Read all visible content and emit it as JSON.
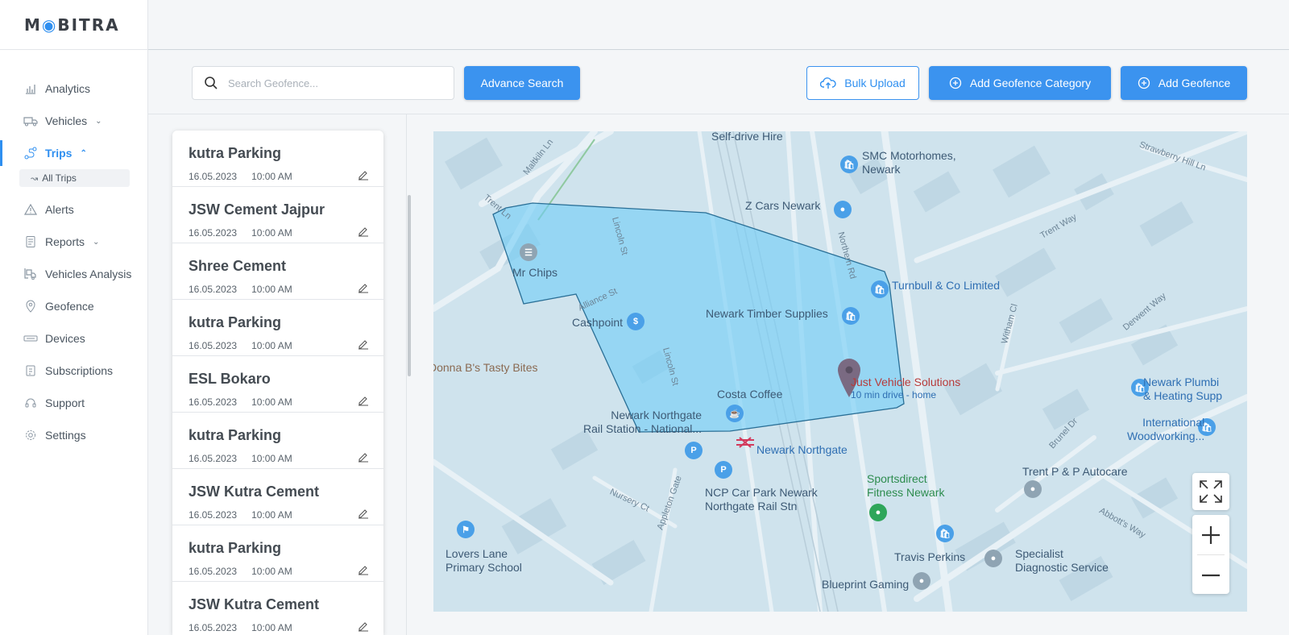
{
  "app": {
    "logo": "MOBITRA"
  },
  "sidebar": {
    "items": [
      {
        "label": "Analytics",
        "icon": "chart-icon"
      },
      {
        "label": "Vehicles",
        "icon": "truck-icon",
        "chevron": "down"
      },
      {
        "label": "Trips",
        "icon": "route-icon",
        "chevron": "up",
        "active": true
      },
      {
        "label": "Alerts",
        "icon": "alert-icon"
      },
      {
        "label": "Reports",
        "icon": "report-icon",
        "chevron": "down"
      },
      {
        "label": "Vehicles Analysis",
        "icon": "truck-analysis-icon"
      },
      {
        "label": "Geofence",
        "icon": "location-pin-icon"
      },
      {
        "label": "Devices",
        "icon": "device-icon"
      },
      {
        "label": "Subscriptions",
        "icon": "subscription-icon"
      },
      {
        "label": "Support",
        "icon": "headset-icon"
      },
      {
        "label": "Settings",
        "icon": "gear-icon"
      }
    ],
    "sub_item": {
      "label": "All Trips",
      "icon": "route-icon"
    }
  },
  "toolbar": {
    "search_placeholder": "Search Geofence...",
    "advance_search": "Advance Search",
    "bulk_upload": "Bulk Upload",
    "add_category": "Add Geofence Category",
    "add_geofence": "Add Geofence",
    "accent": "#3b93ef"
  },
  "geofences": [
    {
      "name": "kutra Parking",
      "date": "16.05.2023",
      "time": "10:00 AM"
    },
    {
      "name": "JSW Cement Jajpur",
      "date": "16.05.2023",
      "time": "10:00 AM"
    },
    {
      "name": "Shree Cement",
      "date": "16.05.2023",
      "time": "10:00 AM"
    },
    {
      "name": "kutra Parking",
      "date": "16.05.2023",
      "time": "10:00 AM"
    },
    {
      "name": "ESL Bokaro",
      "date": "16.05.2023",
      "time": "10:00 AM"
    },
    {
      "name": "kutra Parking",
      "date": "16.05.2023",
      "time": "10:00 AM"
    },
    {
      "name": "JSW Kutra Cement",
      "date": "16.05.2023",
      "time": "10:00 AM"
    },
    {
      "name": "kutra Parking",
      "date": "16.05.2023",
      "time": "10:00 AM"
    },
    {
      "name": "JSW Kutra Cement",
      "date": "16.05.2023",
      "time": "10:00 AM"
    }
  ],
  "map": {
    "places": {
      "self_drive": "Self-drive Hire",
      "smc": "SMC Motorhomes,\nNewark",
      "zcars": "Z Cars Newark",
      "mrchips": "Mr Chips",
      "turnbull": "Turnbull & Co Limited",
      "timber": "Newark Timber Supplies",
      "cashpoint": "Cashpoint",
      "donna": "Donna B's Tasty Bites",
      "jvs": "Just Vehicle Solutions",
      "jvs_sub": "10 min drive - home",
      "costa": "Costa Coffee",
      "station": "Newark Northgate\nRail Station - National...",
      "northgate": "Newark Northgate",
      "ncp": "NCP Car Park Newark\nNorthgate Rail Stn",
      "sportsdirect": "Sportsdirect\nFitness Newark",
      "lovers": "Lovers Lane\nPrimary School",
      "travis": "Travis Perkins",
      "blueprint": "Blueprint Gaming",
      "trentp": "Trent P & P Autocare",
      "specialist": "Specialist\nDiagnostic Service",
      "international": "International\nWoodworking...",
      "plumbing": "Newark Plumbi\n& Heating Supp"
    },
    "streets": {
      "maltkiln": "Maltkiln Ln",
      "trent_ln": "Trent Ln",
      "lincoln1": "Lincoln St",
      "lincoln2": "Lincoln St",
      "alliance": "Alliance St",
      "northern": "Northern Rd",
      "trent_way": "Trent Way",
      "strawberry": "Strawberry Hill Ln",
      "witham": "Witham Cl",
      "derwent": "Derwent Way",
      "brunel_dr": "Brunel Dr",
      "nursery": "Nursery Ct",
      "appleton": "Appleton Gate",
      "abbotts": "Abbott's Way"
    },
    "fence_color": "#6fcdf6"
  }
}
